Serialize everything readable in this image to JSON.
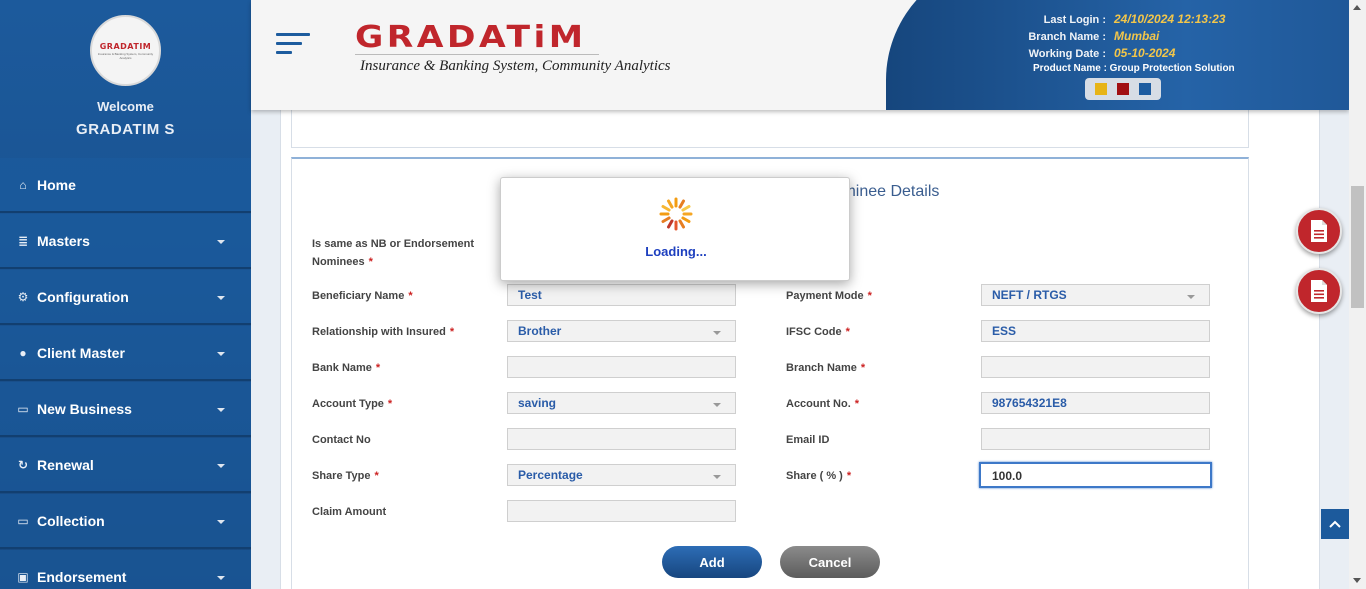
{
  "user": {
    "welcome": "Welcome",
    "name": "GRADATIM S"
  },
  "avatar": {
    "brand": "GRADATIM",
    "tagline": "Insurance & Banking System, Community Analytics"
  },
  "sidebar": {
    "items": [
      {
        "label": "Home",
        "icon": "home-icon",
        "glyph": "⌂"
      },
      {
        "label": "Masters",
        "icon": "database-icon",
        "glyph": "≣"
      },
      {
        "label": "Configuration",
        "icon": "cogs-icon",
        "glyph": "⚙"
      },
      {
        "label": "Client Master",
        "icon": "user-icon",
        "glyph": "●"
      },
      {
        "label": "New Business",
        "icon": "desktop-icon",
        "glyph": "▭"
      },
      {
        "label": "Renewal",
        "icon": "refresh-icon",
        "glyph": "↻"
      },
      {
        "label": "Collection",
        "icon": "desktop-icon",
        "glyph": "▭"
      },
      {
        "label": "Endorsement",
        "icon": "briefcase-icon",
        "glyph": "▣"
      }
    ]
  },
  "header": {
    "logo": "GRADATiM",
    "logo_sub": "Insurance & Banking System, Community Analytics",
    "last_login_label": "Last Login :",
    "last_login": "24/10/2024 12:13:23",
    "branch_label": "Branch Name :",
    "branch": "Mumbai",
    "working_date_label": "Working Date :",
    "working_date": "05-10-2024",
    "product": "Product Name : Group Protection Solution",
    "theme_colors": [
      "#e7b416",
      "#a10f12",
      "#1d5ca0"
    ]
  },
  "form": {
    "section_title": "Nominee Details",
    "same_as_label_1": "Is same as NB or Endorsement",
    "same_as_label_2": "Nominees",
    "beneficiary_name_label": "Beneficiary Name",
    "beneficiary_name": "Test",
    "payment_mode_label": "Payment Mode",
    "payment_mode": "NEFT / RTGS",
    "relationship_label": "Relationship with Insured",
    "relationship": "Brother",
    "ifsc_label": "IFSC Code",
    "ifsc": "ESS",
    "bank_name_label": "Bank Name",
    "bank_name": "",
    "branch_name_label": "Branch Name",
    "branch_name": "",
    "account_type_label": "Account Type",
    "account_type": "saving",
    "account_no_label": "Account No.",
    "account_no": "987654321E8",
    "contact_no_label": "Contact No",
    "contact_no": "",
    "email_label": "Email ID",
    "email": "",
    "share_type_label": "Share Type",
    "share_type": "Percentage",
    "share_pct_label": "Share ( % )",
    "share_pct": "100.0",
    "claim_amount_label": "Claim Amount",
    "claim_amount": "",
    "required_marker": "*",
    "add_label": "Add",
    "cancel_label": "Cancel"
  },
  "loading": {
    "text": "Loading..."
  }
}
